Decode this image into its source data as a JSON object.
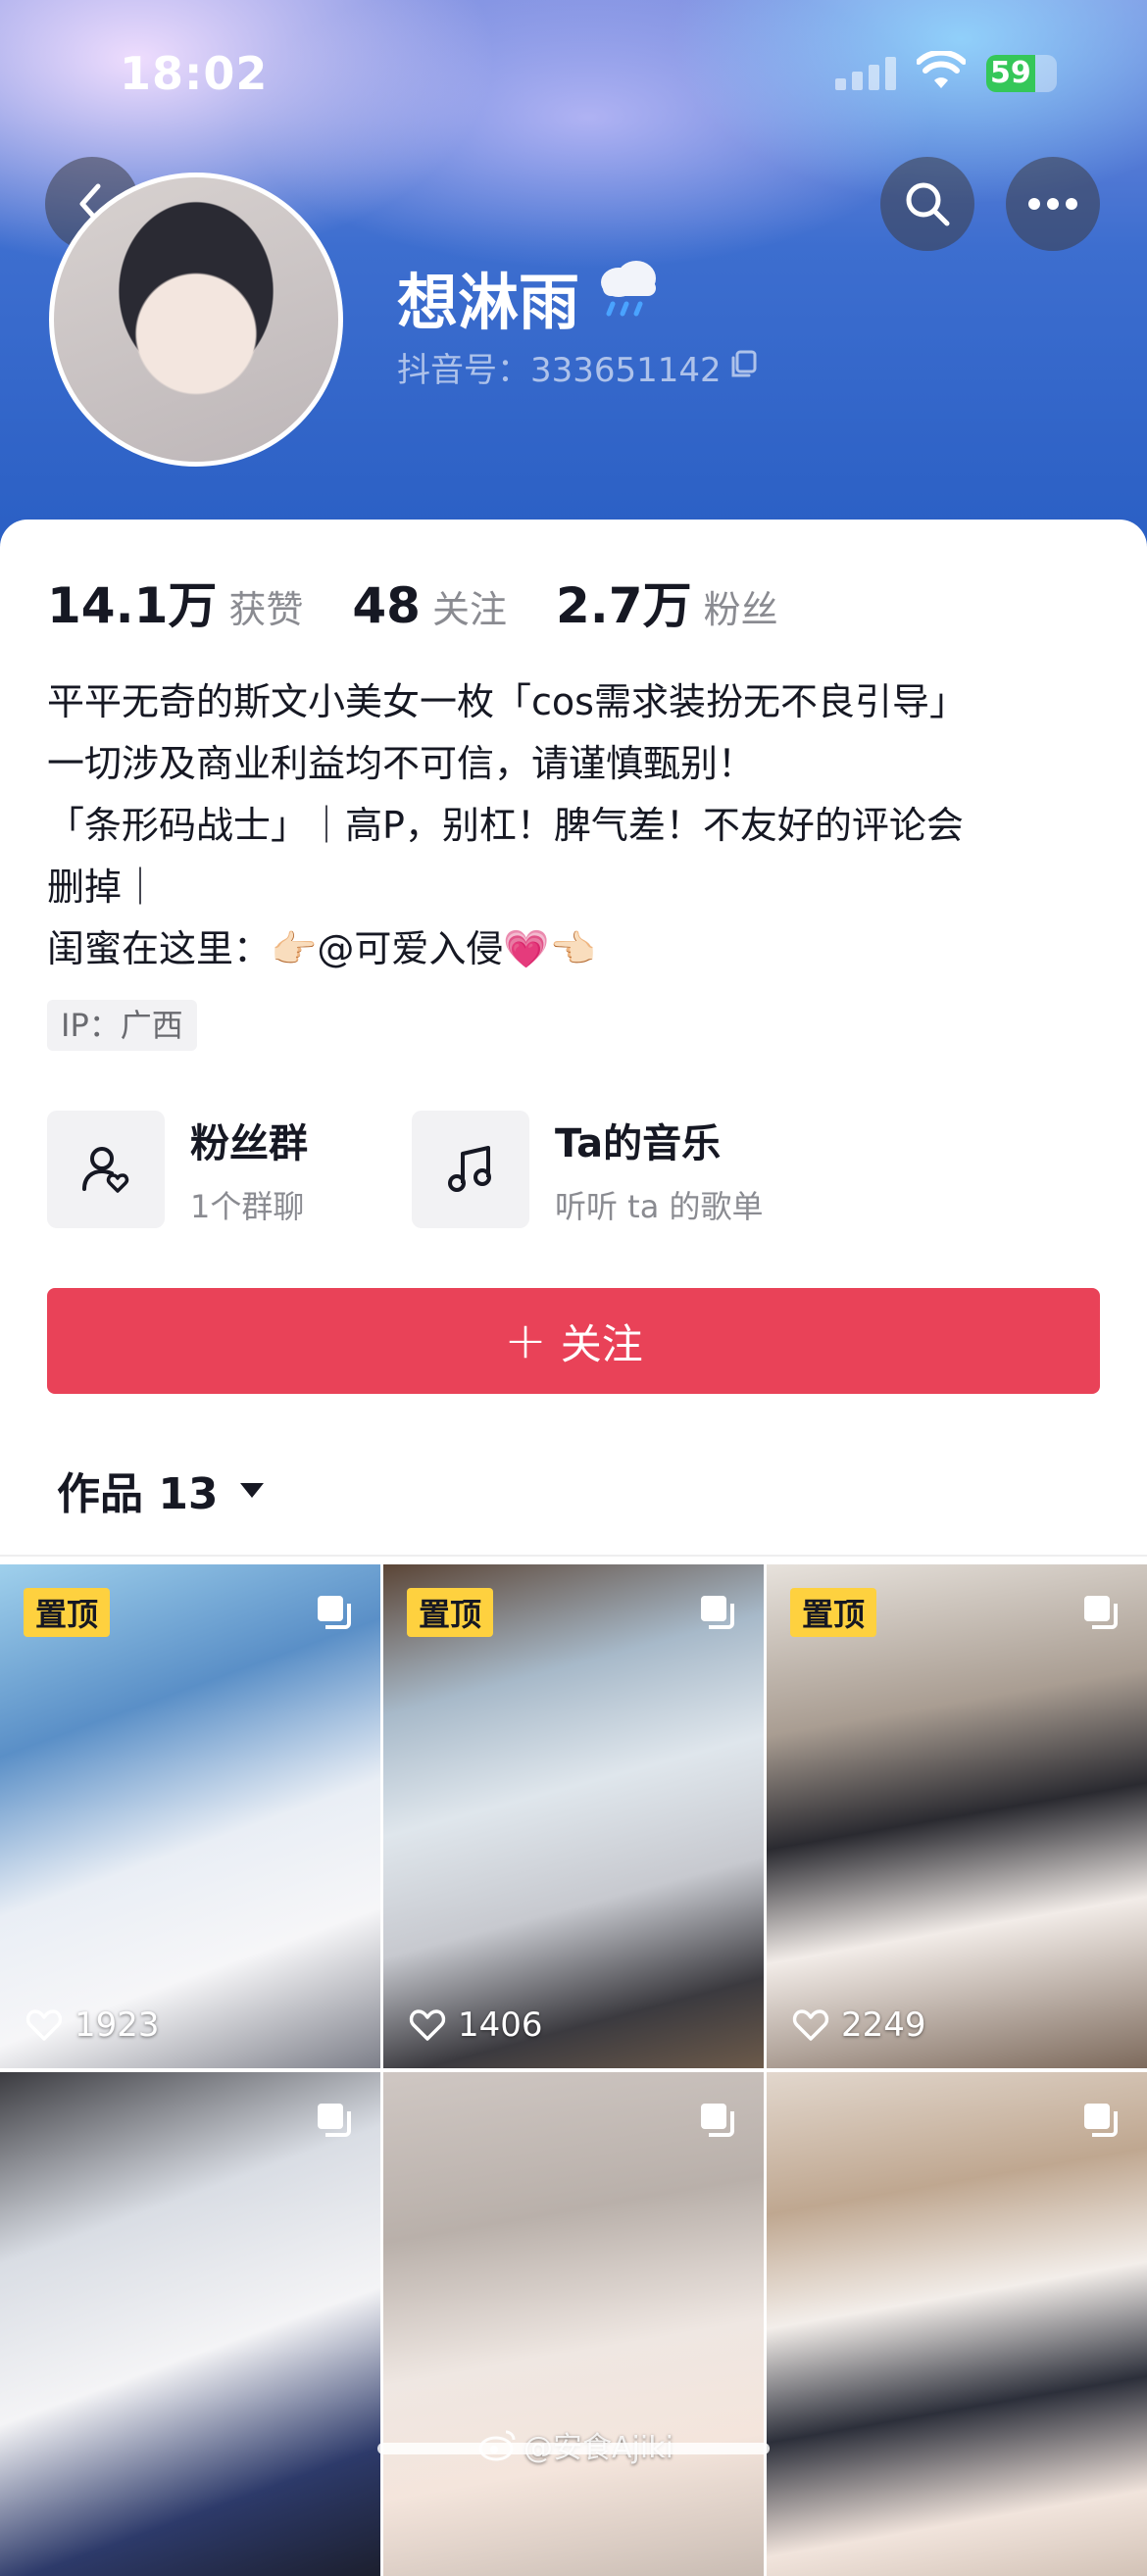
{
  "status_bar": {
    "time": "18:02",
    "battery": "59"
  },
  "profile": {
    "name": "想淋雨",
    "douyin_id": "抖音号：333651142",
    "stats": [
      {
        "num": "14.1万",
        "label": "获赞"
      },
      {
        "num": "48",
        "label": "关注"
      },
      {
        "num": "2.7万",
        "label": "粉丝"
      }
    ],
    "bio": [
      "平平无奇的斯文小美女一枚「cos需求装扮无不良引导」",
      "一切涉及商业利益均不可信，请谨慎甄别！",
      "「条形码战士」｜高P，别杠！脾气差！不友好的评论会",
      "删掉｜",
      "闺蜜在这里：👉🏻@可爱入侵💗👈🏻"
    ],
    "ip": "IP：广西"
  },
  "features": [
    {
      "title": "粉丝群",
      "subtitle": "1个群聊",
      "icon": "fan-group-icon"
    },
    {
      "title": "Ta的音乐",
      "subtitle": "听听 ta 的歌单",
      "icon": "music-note-icon"
    }
  ],
  "follow_button": {
    "plus": "+",
    "label": "关注"
  },
  "works": {
    "label": "作品 13"
  },
  "videos": [
    {
      "pinned": "置顶",
      "likes": "1923"
    },
    {
      "pinned": "置顶",
      "likes": "1406"
    },
    {
      "pinned": "置顶",
      "likes": "2249"
    },
    {
      "pinned": "",
      "likes": ""
    },
    {
      "pinned": "",
      "likes": ""
    },
    {
      "pinned": "",
      "likes": ""
    }
  ],
  "watermark": "@安食Ajiki",
  "colors": {
    "follow": "#e94258",
    "pin_badge": "#fed13f",
    "header_blue": "#2a5fc4"
  }
}
